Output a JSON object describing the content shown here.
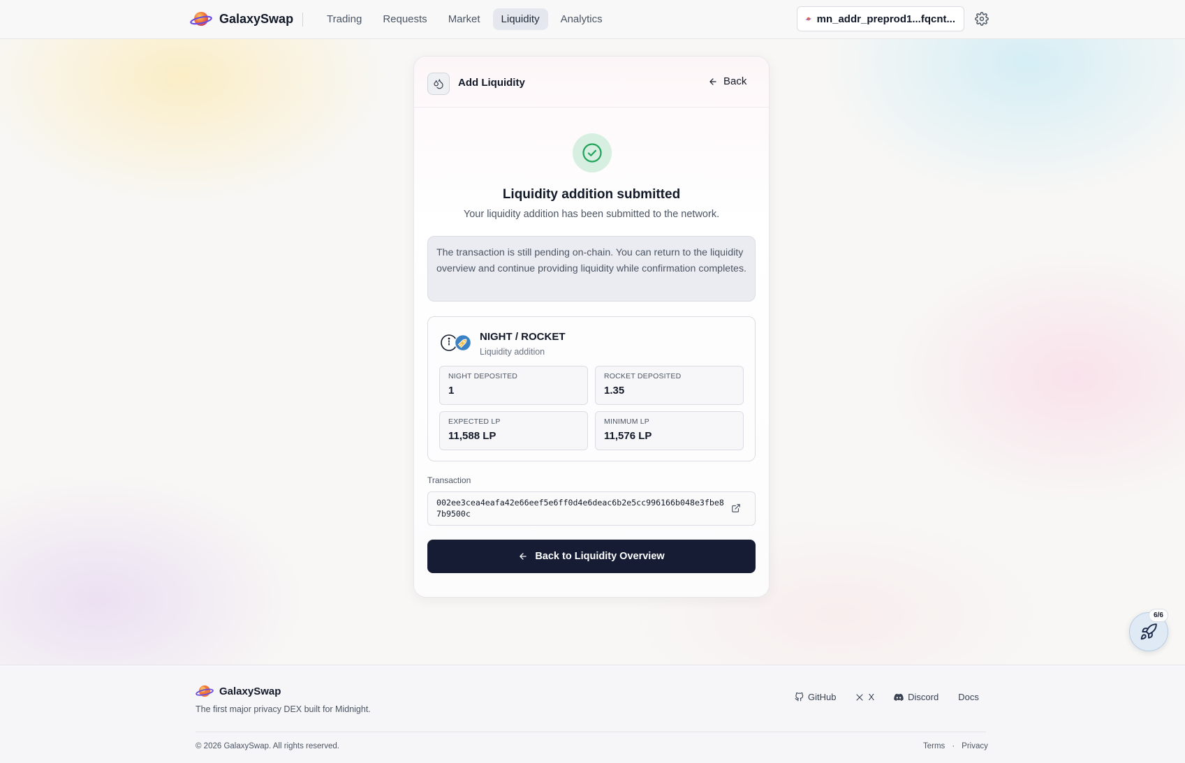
{
  "header": {
    "brand": "GalaxySwap",
    "nav": [
      {
        "label": "Trading",
        "active": false
      },
      {
        "label": "Requests",
        "active": false
      },
      {
        "label": "Market",
        "active": false
      },
      {
        "label": "Liquidity",
        "active": true
      },
      {
        "label": "Analytics",
        "active": false
      }
    ],
    "wallet_address": "mn_addr_preprod1...fqcnt..."
  },
  "card": {
    "title": "Add Liquidity",
    "back_label": "Back",
    "success_title": "Liquidity addition submitted",
    "success_subtitle": "Your liquidity addition has been submitted to the network.",
    "notice": "The transaction is still pending on-chain. You can return to the liquidity overview and continue providing liquidity while confirmation completes.",
    "pair": {
      "name": "NIGHT / ROCKET",
      "subtitle": "Liquidity addition",
      "stats": [
        {
          "label": "NIGHT DEPOSITED",
          "value": "1"
        },
        {
          "label": "ROCKET DEPOSITED",
          "value": "1.35"
        },
        {
          "label": "EXPECTED LP",
          "value": "11,588 LP"
        },
        {
          "label": "MINIMUM LP",
          "value": "11,576 LP"
        }
      ]
    },
    "transaction_label": "Transaction",
    "transaction_hash": "002ee3cea4eafa42e66eef5e6ff0d4e6deac6b2e5cc996166b048e3fbe87b9500c",
    "primary_button": "Back to Liquidity Overview"
  },
  "float_badge": "6/6",
  "footer": {
    "brand": "GalaxySwap",
    "tagline": "The first major privacy DEX built for Midnight.",
    "links": [
      "GitHub",
      "X",
      "Discord",
      "Docs"
    ],
    "copyright": "© 2026 GalaxySwap. All rights reserved.",
    "legal": [
      "Terms",
      "·",
      "Privacy"
    ]
  },
  "colors": {
    "primary": "#161c34",
    "success_bg": "#d6efe1",
    "success_icon": "#22a35a"
  }
}
